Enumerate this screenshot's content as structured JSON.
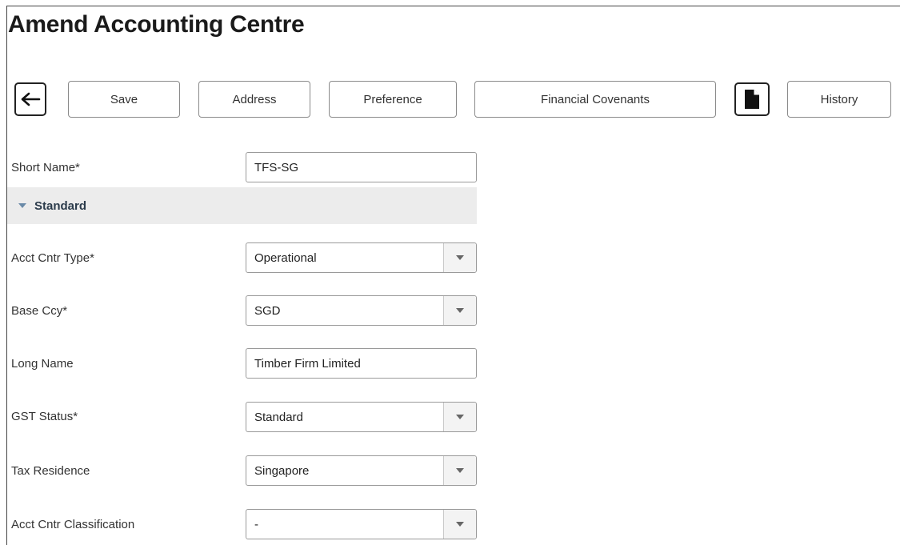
{
  "page": {
    "title": "Amend Accounting Centre"
  },
  "toolbar": {
    "back_icon": "arrow-left-icon",
    "save_label": "Save",
    "address_label": "Address",
    "preference_label": "Preference",
    "financial_covenants_label": "Financial Covenants",
    "document_icon": "document-icon",
    "history_label": "History"
  },
  "form": {
    "short_name": {
      "label": "Short Name*",
      "value": "TFS-SG"
    },
    "section": {
      "label": "Standard",
      "expanded": true
    },
    "acct_cntr_type": {
      "label": "Acct Cntr Type*",
      "value": "Operational"
    },
    "base_ccy": {
      "label": "Base Ccy*",
      "value": "SGD"
    },
    "long_name": {
      "label": "Long Name",
      "value": "Timber Firm Limited"
    },
    "gst_status": {
      "label": "GST Status*",
      "value": "Standard"
    },
    "tax_residence": {
      "label": "Tax Residence",
      "value": "Singapore"
    },
    "acct_cntr_classification": {
      "label": "Acct Cntr Classification",
      "value": "-"
    }
  },
  "colors": {
    "section_bg": "#ececec",
    "section_text": "#2b3b4b",
    "border": "#9a9a9a"
  }
}
